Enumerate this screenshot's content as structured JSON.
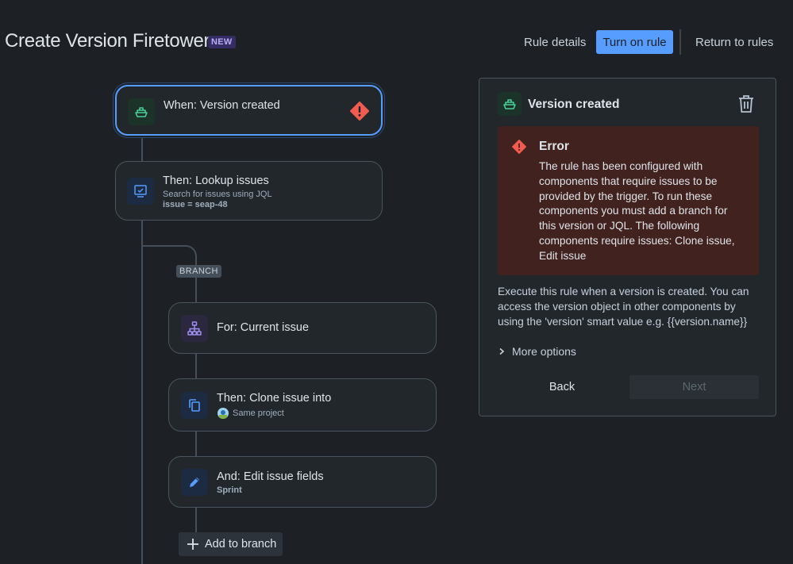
{
  "header": {
    "title": "Create Version Firetower",
    "badge": "NEW",
    "rule_details": "Rule details",
    "turn_on": "Turn on rule",
    "return": "Return to rules"
  },
  "flow": {
    "trigger": {
      "title": "When: Version created"
    },
    "lookup": {
      "title": "Then: Lookup issues",
      "subtitle": "Search for issues using JQL",
      "detail": "issue = seap-48"
    },
    "branch_label": "BRANCH",
    "for_current": {
      "title": "For: Current issue"
    },
    "clone": {
      "title": "Then: Clone issue into",
      "subtitle": "Same project"
    },
    "edit": {
      "title": "And: Edit issue fields",
      "subtitle": "Sprint"
    },
    "add_branch": "Add to branch"
  },
  "panel": {
    "title": "Version created",
    "error_title": "Error",
    "error_text": "The rule has been configured with components that require issues to be provided by the trigger. To run these components you must add a branch for this version or JQL. The following components require issues: Clone issue, Edit issue",
    "description": "Execute this rule when a version is created. You can access the version object in other components by using the 'version' smart value e.g. {{version.name}}",
    "more_options": "More options",
    "back": "Back",
    "next": "Next"
  },
  "colors": {
    "accent": "#579dff",
    "error_bg": "#42221f",
    "error_icon": "#f15b50",
    "trigger_icon": "#4bce97",
    "action_icon": "#579dff",
    "branch_icon": "#9f8fef"
  },
  "icons": [
    "ship-icon",
    "error-icon",
    "lookup-icon",
    "branch-tree-icon",
    "copy-icon",
    "pencil-icon",
    "plus-icon",
    "trash-icon",
    "chevron-right-icon",
    "project-avatar-icon"
  ]
}
